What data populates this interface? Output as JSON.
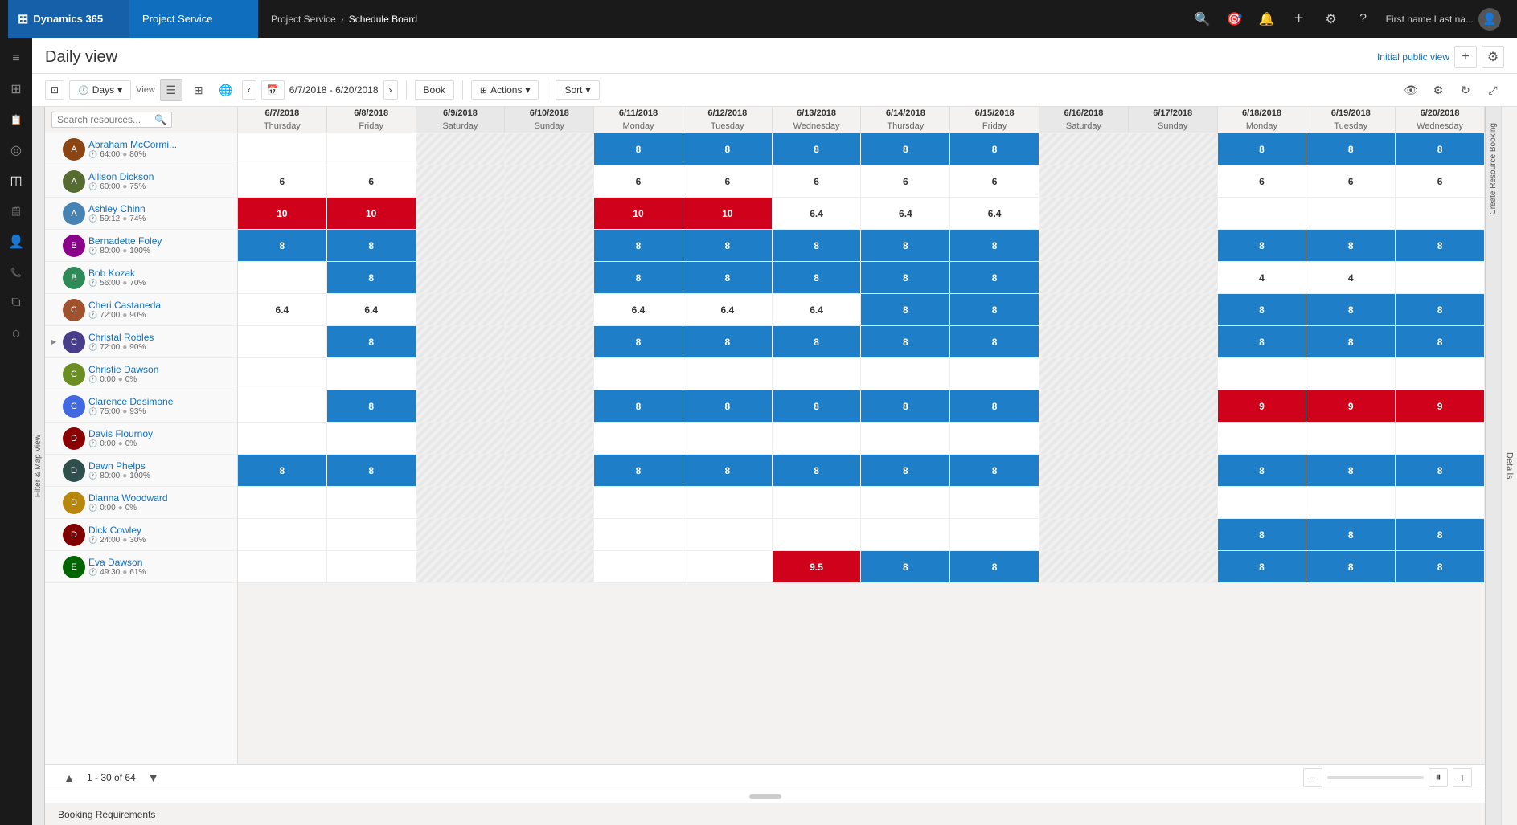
{
  "topnav": {
    "brand": "Dynamics 365",
    "app": "Project Service",
    "breadcrumb1": "Project Service",
    "breadcrumb2": "Schedule Board",
    "user": "First name Last na..."
  },
  "page": {
    "title": "Daily view",
    "view_label": "Initial public view",
    "pagination": "1 - 30 of 64",
    "booking_requirements": "Booking Requirements"
  },
  "toolbar": {
    "days_label": "Days",
    "view_label": "View",
    "date_range": "6/7/2018 - 6/20/2018",
    "book_label": "Book",
    "actions_label": "Actions",
    "sort_label": "Sort"
  },
  "search": {
    "placeholder": "Search resources..."
  },
  "dates": [
    {
      "date": "6/7/2018",
      "day": "Thursday",
      "weekend": false
    },
    {
      "date": "6/8/2018",
      "day": "Friday",
      "weekend": false
    },
    {
      "date": "6/9/2018",
      "day": "Saturday",
      "weekend": true
    },
    {
      "date": "6/10/2018",
      "day": "Sunday",
      "weekend": true
    },
    {
      "date": "6/11/2018",
      "day": "Monday",
      "weekend": false
    },
    {
      "date": "6/12/2018",
      "day": "Tuesday",
      "weekend": false
    },
    {
      "date": "6/13/2018",
      "day": "Wednesday",
      "weekend": false
    },
    {
      "date": "6/14/2018",
      "day": "Thursday",
      "weekend": false
    },
    {
      "date": "6/15/2018",
      "day": "Friday",
      "weekend": false
    },
    {
      "date": "6/16/2018",
      "day": "Saturday",
      "weekend": true
    },
    {
      "date": "6/17/2018",
      "day": "Sunday",
      "weekend": true
    },
    {
      "date": "6/18/2018",
      "day": "Monday",
      "weekend": false
    },
    {
      "date": "6/19/2018",
      "day": "Tuesday",
      "weekend": false
    },
    {
      "date": "6/20/2018",
      "day": "Wednesday",
      "weekend": false
    }
  ],
  "resources": [
    {
      "name": "Abraham McCormi...",
      "hours": "64:00",
      "clock": true,
      "pct": "80%",
      "expand": false,
      "cells": [
        "",
        "",
        "",
        "",
        "8",
        "8",
        "8",
        "8",
        "8",
        "",
        "",
        "8",
        "8",
        "8"
      ],
      "cell_types": [
        "empty",
        "empty",
        "weekend",
        "weekend",
        "blue",
        "blue",
        "blue",
        "blue",
        "blue",
        "weekend",
        "weekend",
        "blue",
        "blue",
        "blue"
      ]
    },
    {
      "name": "Allison Dickson",
      "hours": "60:00",
      "clock": true,
      "pct": "75%",
      "expand": false,
      "cells": [
        "6",
        "6",
        "",
        "",
        "6",
        "6",
        "6",
        "6",
        "6",
        "",
        "",
        "6",
        "6",
        "6"
      ],
      "cell_types": [
        "light",
        "light",
        "weekend",
        "weekend",
        "light",
        "light",
        "light",
        "light",
        "light",
        "weekend",
        "weekend",
        "light",
        "light",
        "light"
      ]
    },
    {
      "name": "Ashley Chinn",
      "hours": "59:12",
      "clock": true,
      "pct": "74%",
      "expand": false,
      "cells": [
        "10",
        "10",
        "",
        "",
        "10",
        "10",
        "6.4",
        "6.4",
        "6.4",
        "",
        "",
        "",
        "",
        ""
      ],
      "cell_types": [
        "red",
        "red",
        "weekend",
        "weekend",
        "red",
        "red",
        "light",
        "light",
        "light",
        "weekend",
        "weekend",
        "empty",
        "empty",
        "empty"
      ]
    },
    {
      "name": "Bernadette Foley",
      "hours": "80:00",
      "clock": true,
      "pct": "100%",
      "expand": false,
      "cells": [
        "8",
        "8",
        "",
        "",
        "8",
        "8",
        "8",
        "8",
        "8",
        "",
        "",
        "8",
        "8",
        "8"
      ],
      "cell_types": [
        "blue",
        "blue",
        "weekend",
        "weekend",
        "blue",
        "blue",
        "blue",
        "blue",
        "blue",
        "weekend",
        "weekend",
        "blue",
        "blue",
        "blue"
      ]
    },
    {
      "name": "Bob Kozak",
      "hours": "56:00",
      "clock": true,
      "pct": "70%",
      "expand": false,
      "cells": [
        "",
        "8",
        "",
        "",
        "8",
        "8",
        "8",
        "8",
        "8",
        "",
        "",
        "4",
        "4",
        ""
      ],
      "cell_types": [
        "empty",
        "blue",
        "weekend",
        "weekend",
        "blue",
        "blue",
        "blue",
        "blue",
        "blue",
        "weekend",
        "weekend",
        "light",
        "light",
        "empty"
      ]
    },
    {
      "name": "Cheri Castaneda",
      "hours": "72:00",
      "clock": true,
      "pct": "90%",
      "expand": false,
      "cells": [
        "6.4",
        "6.4",
        "",
        "",
        "6.4",
        "6.4",
        "6.4",
        "8",
        "8",
        "",
        "",
        "8",
        "8",
        "8"
      ],
      "cell_types": [
        "light",
        "light",
        "weekend",
        "weekend",
        "light",
        "light",
        "light",
        "blue",
        "blue",
        "weekend",
        "weekend",
        "blue",
        "blue",
        "blue"
      ]
    },
    {
      "name": "Christal Robles",
      "hours": "72:00",
      "clock": true,
      "pct": "90%",
      "expand": true,
      "cells": [
        "",
        "8",
        "",
        "",
        "8",
        "8",
        "8",
        "8",
        "8",
        "",
        "",
        "8",
        "8",
        "8"
      ],
      "cell_types": [
        "empty",
        "blue",
        "weekend",
        "weekend",
        "blue",
        "blue",
        "blue",
        "blue",
        "blue",
        "weekend",
        "weekend",
        "blue",
        "blue",
        "blue"
      ]
    },
    {
      "name": "Christie Dawson",
      "hours": "0:00",
      "clock": true,
      "pct": "0%",
      "expand": false,
      "cells": [
        "",
        "",
        "",
        "",
        "",
        "",
        "",
        "",
        "",
        "",
        "",
        "",
        "",
        ""
      ],
      "cell_types": [
        "empty",
        "empty",
        "weekend",
        "weekend",
        "empty",
        "empty",
        "empty",
        "empty",
        "empty",
        "weekend",
        "weekend",
        "empty",
        "empty",
        "empty"
      ]
    },
    {
      "name": "Clarence Desimone",
      "hours": "75:00",
      "clock": true,
      "pct": "93%",
      "expand": false,
      "cells": [
        "",
        "8",
        "",
        "",
        "8",
        "8",
        "8",
        "8",
        "8",
        "",
        "",
        "9",
        "9",
        "9"
      ],
      "cell_types": [
        "empty",
        "blue",
        "weekend",
        "weekend",
        "blue",
        "blue",
        "blue",
        "blue",
        "blue",
        "weekend",
        "weekend",
        "red",
        "red",
        "red"
      ]
    },
    {
      "name": "Davis Flournoy",
      "hours": "0:00",
      "clock": true,
      "pct": "0%",
      "expand": false,
      "cells": [
        "",
        "",
        "",
        "",
        "",
        "",
        "",
        "",
        "",
        "",
        "",
        "",
        "",
        ""
      ],
      "cell_types": [
        "empty",
        "empty",
        "weekend",
        "weekend",
        "empty",
        "empty",
        "empty",
        "empty",
        "empty",
        "weekend",
        "weekend",
        "empty",
        "empty",
        "empty"
      ]
    },
    {
      "name": "Dawn Phelps",
      "hours": "80:00",
      "clock": true,
      "pct": "100%",
      "expand": false,
      "cells": [
        "8",
        "8",
        "",
        "",
        "8",
        "8",
        "8",
        "8",
        "8",
        "",
        "",
        "8",
        "8",
        "8"
      ],
      "cell_types": [
        "blue",
        "blue",
        "weekend",
        "weekend",
        "blue",
        "blue",
        "blue",
        "blue",
        "blue",
        "weekend",
        "weekend",
        "blue",
        "blue",
        "blue"
      ]
    },
    {
      "name": "Dianna Woodward",
      "hours": "0:00",
      "clock": true,
      "pct": "0%",
      "expand": false,
      "cells": [
        "",
        "",
        "",
        "",
        "",
        "",
        "",
        "",
        "",
        "",
        "",
        "",
        "",
        ""
      ],
      "cell_types": [
        "empty",
        "empty",
        "weekend",
        "weekend",
        "empty",
        "empty",
        "empty",
        "empty",
        "empty",
        "weekend",
        "weekend",
        "empty",
        "empty",
        "empty"
      ]
    },
    {
      "name": "Dick Cowley",
      "hours": "24:00",
      "clock": true,
      "pct": "30%",
      "expand": false,
      "cells": [
        "",
        "",
        "",
        "",
        "",
        "",
        "",
        "",
        "",
        "",
        "",
        "8",
        "8",
        "8"
      ],
      "cell_types": [
        "empty",
        "empty",
        "weekend",
        "weekend",
        "empty",
        "empty",
        "empty",
        "empty",
        "empty",
        "weekend",
        "weekend",
        "blue",
        "blue",
        "blue"
      ]
    },
    {
      "name": "Eva Dawson",
      "hours": "49:30",
      "clock": true,
      "pct": "61%",
      "expand": false,
      "cells": [
        "",
        "",
        "",
        "",
        "",
        "",
        "9.5",
        "8",
        "8",
        "",
        "",
        "8",
        "8",
        "8"
      ],
      "cell_types": [
        "empty",
        "empty",
        "weekend",
        "weekend",
        "empty",
        "empty",
        "red",
        "blue",
        "blue",
        "weekend",
        "weekend",
        "blue",
        "blue",
        "blue"
      ]
    }
  ],
  "sidebar_items": [
    {
      "icon": "≡",
      "name": "menu"
    },
    {
      "icon": "⊞",
      "name": "dashboard"
    },
    {
      "icon": "📋",
      "name": "activities"
    },
    {
      "icon": "◎",
      "name": "circle"
    },
    {
      "icon": "◫",
      "name": "grid2"
    },
    {
      "icon": "♪",
      "name": "notes"
    },
    {
      "icon": "👤",
      "name": "user"
    },
    {
      "icon": "📞",
      "name": "phone"
    },
    {
      "icon": "⧉",
      "name": "resource"
    },
    {
      "icon": "⬡",
      "name": "hexagon"
    }
  ],
  "colors": {
    "brand_blue": "#1560a8",
    "app_blue": "#106ebe",
    "cell_blue": "#1e7ec7",
    "cell_red": "#d0021b",
    "nav_dark": "#1a1a1a"
  }
}
